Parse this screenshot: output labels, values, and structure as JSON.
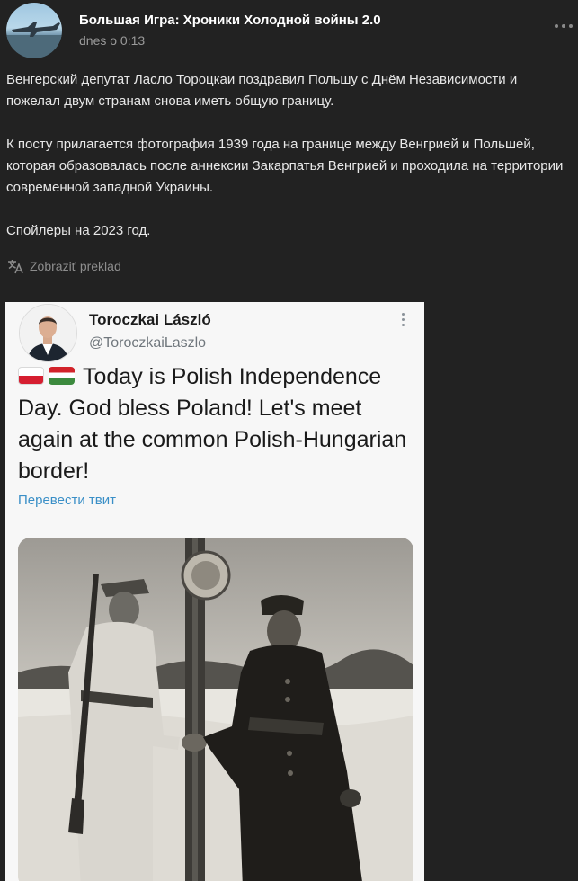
{
  "post": {
    "channel_name": "Большая Игра: Хроники Холодной войны 2.0",
    "time": "dnes o 0:13",
    "paragraphs": [
      "Венгерский депутат Ласло Тороцкаи поздравил Польшу с Днём Независимости и пожелал двум странам снова иметь общую границу.",
      "К посту прилагается фотография 1939 года на границе между Венгрией и Польшей, которая образовалась после аннексии Закарпатья Венгрией и проходила на территории современной западной Украины.",
      "Спойлеры на 2023 год."
    ],
    "translate_label": "Zobraziť preklad"
  },
  "tweet": {
    "name": "Toroczkai László",
    "handle": "@ToroczkaiLaszlo",
    "flags": [
      "flag-poland-icon",
      "flag-hungary-icon"
    ],
    "text": "Today is Polish Independence Day. God bless Poland! Let's meet again at the common Polish-Hungarian border!",
    "translate_label": "Перевести твит"
  },
  "colors": {
    "background": "#222222",
    "card": "#f7f7f7",
    "link": "#3a8fc7"
  }
}
